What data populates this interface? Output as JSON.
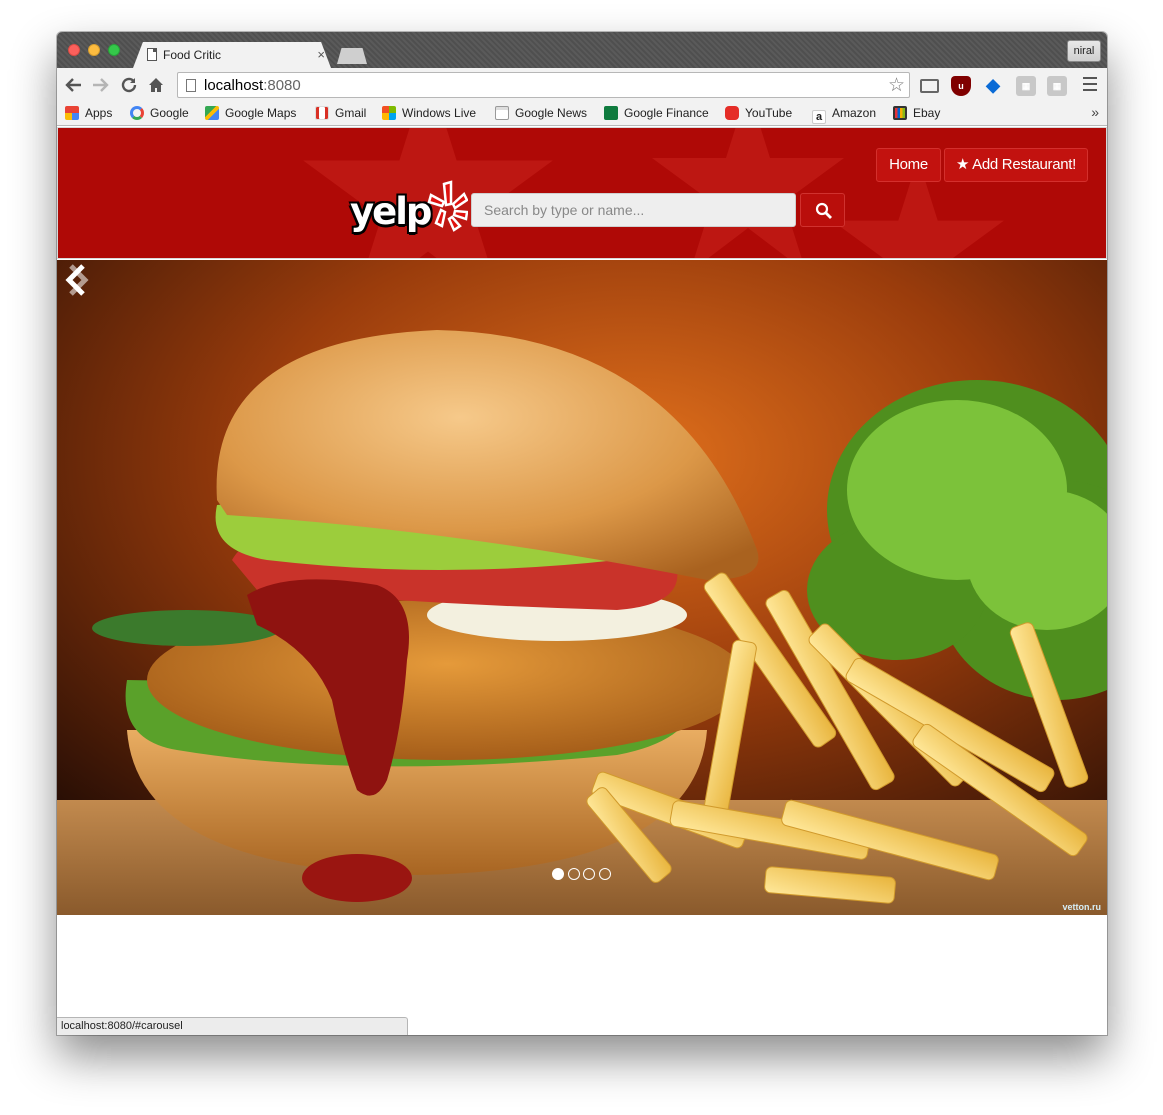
{
  "browser": {
    "tab_title": "Food Critic",
    "tab_close": "×",
    "profile_name": "niral",
    "url_host": "localhost",
    "url_port": ":8080",
    "status_url": "localhost:8080/#carousel",
    "bookmarks_more": "»",
    "bookmarks": [
      {
        "label": "Apps",
        "icon": "apps-grid-icon",
        "color": "#e94335"
      },
      {
        "label": "Google",
        "icon": "google-g-icon",
        "color": "#4285f4"
      },
      {
        "label": "Google Maps",
        "icon": "google-maps-icon",
        "color": "#34a853"
      },
      {
        "label": "Gmail",
        "icon": "gmail-icon",
        "color": "#d93025"
      },
      {
        "label": "Windows Live",
        "icon": "windows-icon",
        "color": "#f25022"
      },
      {
        "label": "Google News",
        "icon": "google-news-icon",
        "color": "#777777"
      },
      {
        "label": "Google Finance",
        "icon": "google-finance-icon",
        "color": "#0f7b3e"
      },
      {
        "label": "YouTube",
        "icon": "youtube-icon",
        "color": "#e52d27"
      },
      {
        "label": "Amazon",
        "icon": "amazon-icon",
        "color": "#222222"
      },
      {
        "label": "Ebay",
        "icon": "ebay-tv-icon",
        "color": "#7a4a2a"
      }
    ],
    "extensions": [
      "cast-icon",
      "ublock-icon",
      "gem-icon",
      "extension-grey-icon",
      "extension-grey-icon"
    ]
  },
  "header": {
    "brand": "yelp",
    "nav": {
      "home": "Home",
      "add_restaurant": "Add Restaurant!"
    },
    "search_placeholder": "Search by type or name...",
    "colors": {
      "background": "#af0906",
      "pill": "#c2120f"
    }
  },
  "carousel": {
    "slide_count": 4,
    "active_index": 0,
    "watermark": "vetton.ru",
    "prev_icon": "chevron-left-icon",
    "next_icon": "chevron-right-icon"
  }
}
